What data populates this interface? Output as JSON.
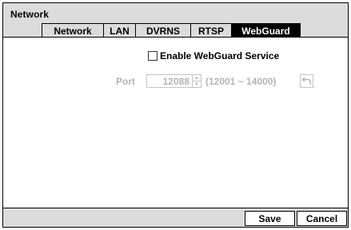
{
  "window": {
    "title": "Network"
  },
  "tabs": [
    {
      "label": "Network",
      "active": false
    },
    {
      "label": "LAN",
      "active": false
    },
    {
      "label": "DVRNS",
      "active": false
    },
    {
      "label": "RTSP",
      "active": false
    },
    {
      "label": "WebGuard",
      "active": true
    }
  ],
  "webguard": {
    "enable_label": "Enable WebGuard Service",
    "enable_checked": false,
    "port_label": "Port",
    "port_value": "12088",
    "port_range": "(12001 ~ 14000)",
    "undo_icon": "undo-arrow-icon"
  },
  "buttons": {
    "save": "Save",
    "cancel": "Cancel"
  },
  "colors": {
    "panel": "#dcdcdc",
    "active_tab": "#000000",
    "disabled_text": "#b4b4b4"
  }
}
